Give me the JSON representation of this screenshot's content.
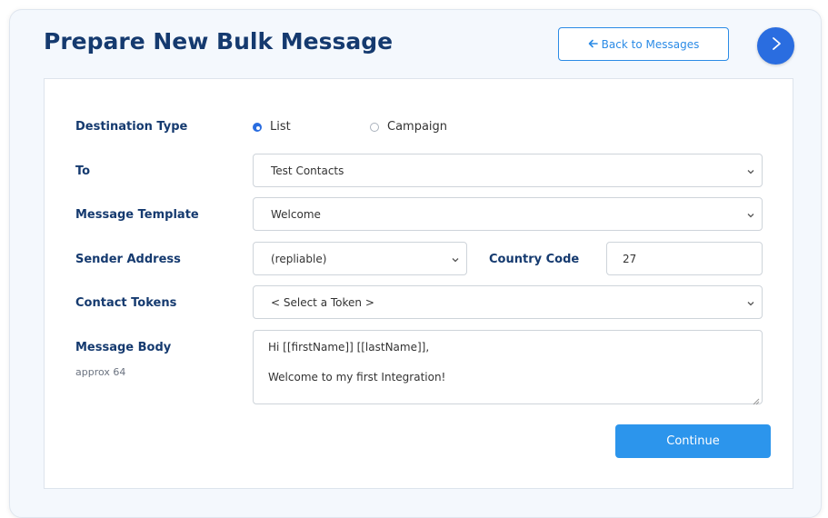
{
  "header": {
    "title": "Prepare New Bulk Message",
    "back_label": "Back to Messages"
  },
  "form": {
    "destination_type": {
      "label": "Destination Type",
      "options": [
        "List",
        "Campaign"
      ],
      "selected": "List"
    },
    "to": {
      "label": "To",
      "value": "Test Contacts"
    },
    "message_template": {
      "label": "Message Template",
      "value": "Welcome"
    },
    "sender_address": {
      "label": "Sender Address",
      "value": "(repliable)"
    },
    "country_code": {
      "label": "Country Code",
      "value": "27"
    },
    "contact_tokens": {
      "label": "Contact Tokens",
      "value": "< Select a Token >"
    },
    "message_body": {
      "label": "Message Body",
      "sublabel": "approx 64",
      "lines": [
        "Hi [[firstName]] [[lastName]],",
        "Welcome to my first Integration!"
      ]
    },
    "continue_label": "Continue"
  },
  "colors": {
    "accent": "#2c95ec",
    "title": "#153a6f",
    "round_button": "#2a6de0"
  },
  "icons": {
    "back": "arrow-left-icon",
    "next": "chevron-right-icon",
    "select": "chevron-down-icon"
  }
}
